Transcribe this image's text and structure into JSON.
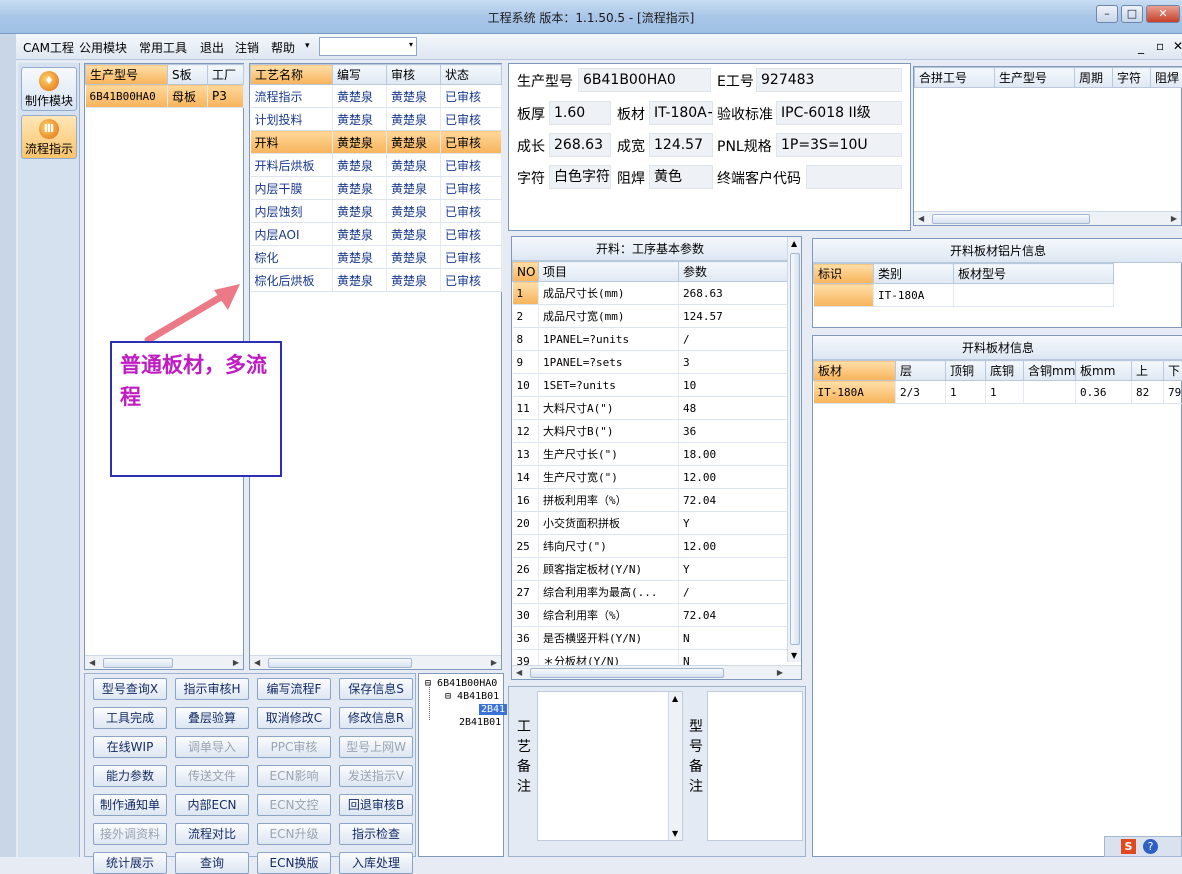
{
  "window": {
    "title": "工程系统  版本：1.1.50.5 - [流程指示]",
    "min": "–",
    "max": "□",
    "close": "✕"
  },
  "menu": {
    "items": [
      "CAM工程",
      "公用模块",
      "常用工具",
      "退出",
      "注销",
      "帮助"
    ],
    "dropdown_arrow": "▾",
    "combo_value": "",
    "min": "_",
    "restore": "▫",
    "close": "✕"
  },
  "sidebar": {
    "items": [
      {
        "label": "制作模块",
        "icon": "flame-icon"
      },
      {
        "label": "流程指示",
        "icon": "flow-icon"
      }
    ]
  },
  "models": {
    "headers": [
      "生产型号",
      "S板",
      "工厂"
    ],
    "rows": [
      [
        "6B41B00HA0",
        "母板",
        "P3"
      ]
    ]
  },
  "process": {
    "headers": [
      "工艺名称",
      "编写",
      "审核",
      "状态"
    ],
    "rows": [
      [
        "流程指示",
        "黄楚泉",
        "黄楚泉",
        "已审核"
      ],
      [
        "计划投料",
        "黄楚泉",
        "黄楚泉",
        "已审核"
      ],
      [
        "开料",
        "黄楚泉",
        "黄楚泉",
        "已审核"
      ],
      [
        "开料后烘板",
        "黄楚泉",
        "黄楚泉",
        "已审核"
      ],
      [
        "内层干膜",
        "黄楚泉",
        "黄楚泉",
        "已审核"
      ],
      [
        "内层蚀刻",
        "黄楚泉",
        "黄楚泉",
        "已审核"
      ],
      [
        "内层AOI",
        "黄楚泉",
        "黄楚泉",
        "已审核"
      ],
      [
        "棕化",
        "黄楚泉",
        "黄楚泉",
        "已审核"
      ],
      [
        "棕化后烘板",
        "黄楚泉",
        "黄楚泉",
        "已审核"
      ]
    ],
    "selected": 2
  },
  "annotation": {
    "text": "普通板材，多流程"
  },
  "info": {
    "prod_model_label": "生产型号",
    "prod_model": "6B41B00HA0",
    "e_no_label": "E工号",
    "e_no": "927483",
    "thickness_label": "板厚",
    "thickness": "1.60",
    "material_label": "板材",
    "material": "IT-180A+",
    "accept_label": "验收标准",
    "accept": "IPC-6018 II级",
    "length_label": "成长",
    "length": "268.63",
    "width_label": "成宽",
    "width": "124.57",
    "pnl_label": "PNL规格",
    "pnl": "1P=3S=10U",
    "char_label": "字符",
    "char": "白色字符",
    "mask_label": "阻焊",
    "mask": "黄色",
    "customer_label": "终端客户代码",
    "customer": ""
  },
  "combine": {
    "headers": [
      "合拼工号",
      "生产型号",
      "周期",
      "字符",
      "阻焊"
    ]
  },
  "params": {
    "title": "开料：工序基本参数",
    "headers": [
      "NO",
      "项目",
      "参数"
    ],
    "rows": [
      [
        "1",
        "成品尺寸长(mm)",
        "268.63"
      ],
      [
        "2",
        "成品尺寸宽(mm)",
        "124.57"
      ],
      [
        "8",
        "1PANEL=?units",
        "/"
      ],
      [
        "9",
        "1PANEL=?sets",
        "3"
      ],
      [
        "10",
        "1SET=?units",
        "10"
      ],
      [
        "11",
        "大料尺寸A(\")",
        "48"
      ],
      [
        "12",
        "大料尺寸B(\")",
        "36"
      ],
      [
        "13",
        "生产尺寸长(\")",
        "18.00"
      ],
      [
        "14",
        "生产尺寸宽(\")",
        "12.00"
      ],
      [
        "16",
        "拼板利用率（%）",
        "72.04"
      ],
      [
        "20",
        "小交货面积拼板",
        "Y"
      ],
      [
        "25",
        "纬向尺寸(\")",
        "12.00"
      ],
      [
        "26",
        "顾客指定板材(Y/N)",
        "Y"
      ],
      [
        "27",
        "综合利用率为最高(...",
        "/"
      ],
      [
        "30",
        "综合利用率（%）",
        "72.04"
      ],
      [
        "36",
        "是否横竖开料(Y/N)",
        "N"
      ],
      [
        "39",
        "＊分板材(Y/N)",
        "N"
      ]
    ],
    "selected": 0
  },
  "foil": {
    "title": "开料板材铝片信息",
    "headers": [
      "标识",
      "类别",
      "板材型号"
    ],
    "rows": [
      [
        "",
        "IT-180A",
        ""
      ]
    ]
  },
  "board": {
    "title": "开料板材信息",
    "headers": [
      "板材",
      "层",
      "顶铜",
      "底铜",
      "含铜mm",
      "板mm",
      "上",
      "下"
    ],
    "rows": [
      [
        "IT-180A",
        "2/3",
        "1",
        "1",
        "",
        "0.36",
        "82",
        "79"
      ]
    ]
  },
  "buttons": [
    [
      "型号查询X",
      "指示审核H",
      "编写流程F",
      "保存信息S"
    ],
    [
      "工具完成",
      "叠层验算",
      "取消修改C",
      "修改信息R"
    ],
    [
      "在线WIP",
      "调单导入",
      "PPC审核",
      "型号上网W"
    ],
    [
      "能力参数",
      "传送文件",
      "ECN影响",
      "发送指示V"
    ],
    [
      "制作通知单",
      "内部ECN",
      "ECN文控",
      "回退审核B"
    ],
    [
      "接外调资料",
      "流程对比",
      "ECN升级",
      "指示检查"
    ],
    [
      "统计展示",
      "查询",
      "ECN换版",
      "入库处理"
    ]
  ],
  "disabled_buttons": [
    "调单导入",
    "PPC审核",
    "型号上网W",
    "传送文件",
    "ECN影响",
    "发送指示V",
    "ECN文控",
    "ECN升级",
    "接外调资料"
  ],
  "tree": {
    "root": "6B41B00HA0",
    "child": "4B41B01",
    "leaf_selected": "2B41",
    "sibling": "2B41B01"
  },
  "notes": {
    "process_label": "工艺备注",
    "model_label": "型号备注"
  },
  "tray": {
    "s_icon": "S",
    "help": "?"
  }
}
